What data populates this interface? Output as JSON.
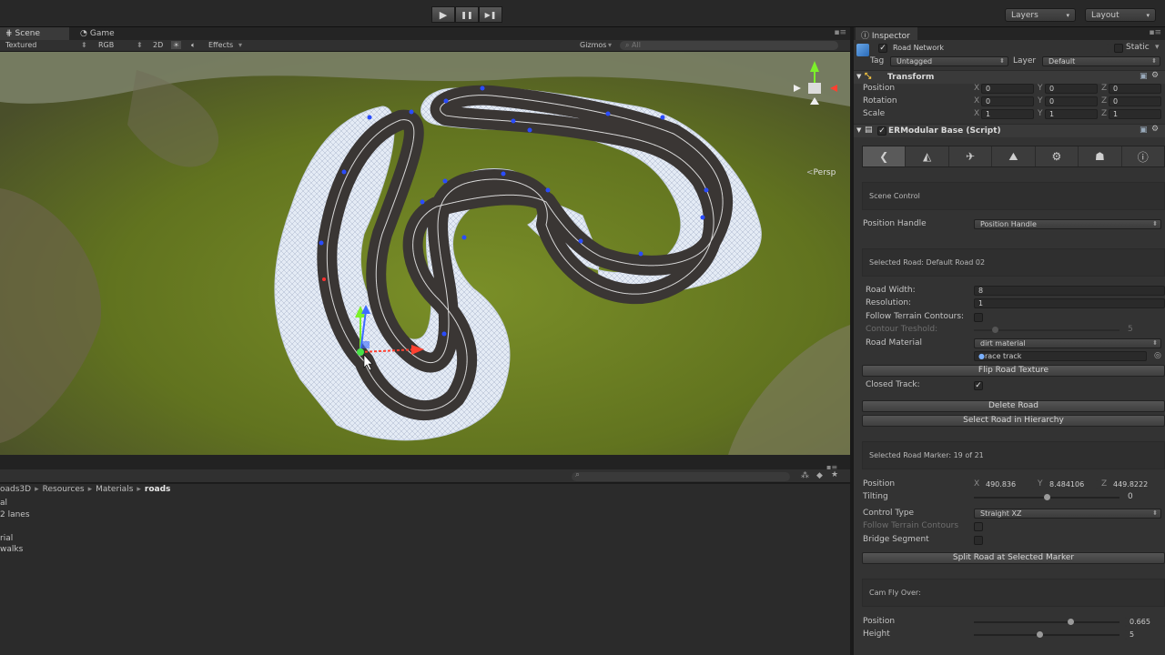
{
  "toolbar": {
    "play": "▶",
    "pause": "❚❚",
    "step": "▶❚",
    "layers_label": "Layers",
    "layout_label": "Layout"
  },
  "scene": {
    "tab_scene": "Scene",
    "tab_game": "Game",
    "shading": "Textured",
    "color_mode": "RGB",
    "mode_2d": "2D",
    "effects_label": "Effects",
    "gizmos_label": "Gizmos",
    "search_placeholder": "All",
    "persp_label": "Persp"
  },
  "project": {
    "breadcrumb": [
      "oads3D",
      "Resources",
      "Materials",
      "roads"
    ],
    "items": [
      "al",
      "2 lanes",
      "",
      "rial",
      "walks"
    ]
  },
  "inspector": {
    "tab_label": "Inspector",
    "object_name": "Road Network",
    "static_label": "Static",
    "tag_label": "Tag",
    "tag_value": "Untagged",
    "layer_label": "Layer",
    "layer_value": "Default",
    "transform": {
      "title": "Transform",
      "rows": [
        {
          "label": "Position",
          "x": "0",
          "y": "0",
          "z": "0"
        },
        {
          "label": "Rotation",
          "x": "0",
          "y": "0",
          "z": "0"
        },
        {
          "label": "Scale",
          "x": "1",
          "y": "1",
          "z": "1"
        }
      ]
    },
    "script_title": "ERModular Base (Script)",
    "scene_control_label": "Scene Control",
    "position_handle_label": "Position Handle",
    "position_handle_value": "Position Handle",
    "selected_road": "Selected Road:  Default Road 02",
    "road_width_label": "Road Width:",
    "road_width_value": "8",
    "resolution_label": "Resolution:",
    "resolution_value": "1",
    "follow_terrain_label": "Follow Terrain Contours:",
    "contour_threshold_label": "Contour Treshold:",
    "contour_threshold_value": "5",
    "road_material_label": "Road Material",
    "road_material_value": "dirt material",
    "road_material_obj": "race track",
    "flip_texture_btn": "Flip Road Texture",
    "closed_track_label": "Closed Track:",
    "delete_road_btn": "Delete Road",
    "select_road_btn": "Select Road in Hierarchy",
    "selected_marker": "Selected Road Marker: 19 of 21",
    "marker_position_label": "Position",
    "marker_x": "490.836",
    "marker_y": "8.484106",
    "marker_z": "449.8222",
    "tilting_label": "Tilting",
    "tilting_value": "0",
    "tilting_fraction": 0.5,
    "control_type_label": "Control Type",
    "control_type_value": "Straight XZ",
    "follow_terrain2_label": "Follow Terrain Contours",
    "bridge_segment_label": "Bridge Segment",
    "split_road_btn": "Split Road at Selected Marker",
    "cam_fly_label": "Cam Fly Over:",
    "cam_position_label": "Position",
    "cam_position_value": "0.665",
    "cam_position_fraction": 0.665,
    "cam_height_label": "Height",
    "cam_height_value": "5",
    "cam_height_fraction": 0.45
  }
}
